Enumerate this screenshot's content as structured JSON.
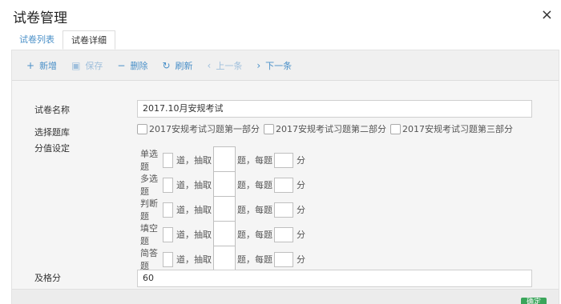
{
  "dialog": {
    "title": "试卷管理",
    "close_label": "×"
  },
  "tabs": [
    {
      "label": "试卷列表"
    },
    {
      "label": "试卷详细"
    }
  ],
  "toolbar": {
    "add": {
      "icon": "+",
      "label": "新增"
    },
    "save": {
      "icon": "▣",
      "label": "保存"
    },
    "delete": {
      "icon": "−",
      "label": "删除"
    },
    "refresh": {
      "icon": "↻",
      "label": "刷新"
    },
    "prev": {
      "icon": "‹",
      "label": "上一条"
    },
    "next": {
      "icon": "›",
      "label": "下一条"
    }
  },
  "form": {
    "name_label": "试卷名称",
    "name_value": "2017.10月安规考试",
    "bank_label": "选择题库",
    "banks": [
      {
        "label": "2017安规考试习题第一部分",
        "checked": false
      },
      {
        "label": "2017安规考试习题第二部分",
        "checked": false
      },
      {
        "label": "2017安规考试习题第三部分",
        "checked": false
      }
    ],
    "score_label": "分值设定",
    "score_rows": [
      {
        "type": "单选题"
      },
      {
        "type": "多选题"
      },
      {
        "type": "判断题"
      },
      {
        "type": "填空题"
      },
      {
        "type": "简答题"
      }
    ],
    "score_text": {
      "dao": "道，抽取",
      "ti": "题，每题",
      "fen": "分"
    },
    "pass_label": "及格分",
    "pass_value": "60"
  },
  "footer": {
    "confirm_label": "确定"
  }
}
